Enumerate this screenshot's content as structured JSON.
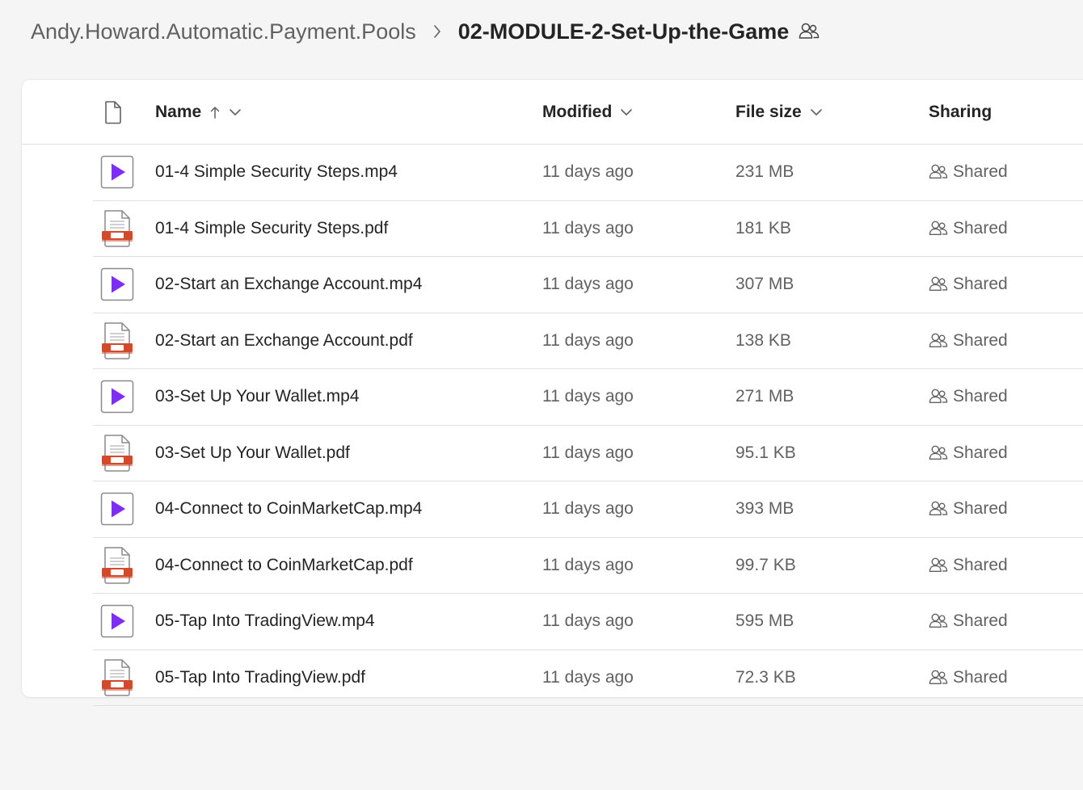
{
  "breadcrumb": {
    "parent": "Andy.Howard.Automatic.Payment.Pools",
    "current": "02-MODULE-2-Set-Up-the-Game"
  },
  "columns": {
    "name": "Name",
    "modified": "Modified",
    "file_size": "File size",
    "sharing": "Sharing"
  },
  "icons": {
    "file_type": "document-icon",
    "video": "video-file-icon",
    "pdf": "pdf-file-icon",
    "shared": "people-icon"
  },
  "colors": {
    "video_accent": "#7b2ff2",
    "pdf_accent": "#d04a2b"
  },
  "files": [
    {
      "name": "01-4 Simple Security Steps.mp4",
      "type": "video",
      "modified": "11 days ago",
      "size": "231 MB",
      "sharing": "Shared"
    },
    {
      "name": "01-4 Simple Security Steps.pdf",
      "type": "pdf",
      "modified": "11 days ago",
      "size": "181 KB",
      "sharing": "Shared"
    },
    {
      "name": "02-Start an Exchange Account.mp4",
      "type": "video",
      "modified": "11 days ago",
      "size": "307 MB",
      "sharing": "Shared"
    },
    {
      "name": "02-Start an Exchange Account.pdf",
      "type": "pdf",
      "modified": "11 days ago",
      "size": "138 KB",
      "sharing": "Shared"
    },
    {
      "name": "03-Set Up Your Wallet.mp4",
      "type": "video",
      "modified": "11 days ago",
      "size": "271 MB",
      "sharing": "Shared"
    },
    {
      "name": "03-Set Up Your Wallet.pdf",
      "type": "pdf",
      "modified": "11 days ago",
      "size": "95.1 KB",
      "sharing": "Shared"
    },
    {
      "name": "04-Connect to CoinMarketCap.mp4",
      "type": "video",
      "modified": "11 days ago",
      "size": "393 MB",
      "sharing": "Shared"
    },
    {
      "name": "04-Connect to CoinMarketCap.pdf",
      "type": "pdf",
      "modified": "11 days ago",
      "size": "99.7 KB",
      "sharing": "Shared"
    },
    {
      "name": "05-Tap Into TradingView.mp4",
      "type": "video",
      "modified": "11 days ago",
      "size": "595 MB",
      "sharing": "Shared"
    },
    {
      "name": "05-Tap Into TradingView.pdf",
      "type": "pdf",
      "modified": "11 days ago",
      "size": "72.3 KB",
      "sharing": "Shared"
    }
  ]
}
